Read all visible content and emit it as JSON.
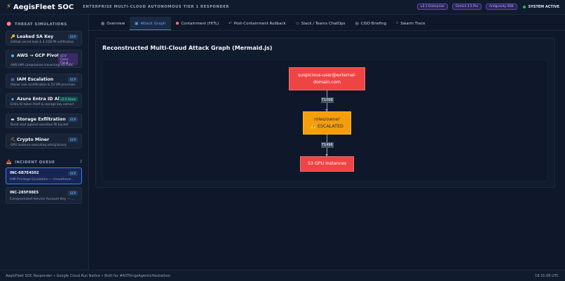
{
  "header": {
    "brand": "AegisFleet SOC",
    "tagline": "ENTERPRISE MULTI-CLOUD AUTONOMOUS TIER 1 RESPONDER",
    "badges": [
      "v2.1 Enterprise",
      "Gemini 3.5 Pro",
      "Antigravity SDK"
    ],
    "status": "SYSTEM ACTIVE"
  },
  "sidebar": {
    "threat_title": "THREAT SIMULATIONS",
    "simulations": [
      {
        "title": "Leaked SA Key",
        "desc": "GitHub secret leak & 4.2GB PII exfiltration",
        "tag": "GCP",
        "icon": "key-icon"
      },
      {
        "title": "AWS → GCP Pivot",
        "desc": "AWS IAM compromise traversing via OIDC",
        "tag": "v2.0 Cross-Cloud",
        "icon": "globe-icon"
      },
      {
        "title": "IAM Escalation",
        "desc": "Owner role modification & 53 VM provision",
        "tag": "GCP",
        "icon": "lock-icon"
      },
      {
        "title": "Azure Entra ID Abuse",
        "desc": "Entra ID token theft & storage key extract",
        "tag": "v2.0 Azure",
        "icon": "cloud-icon"
      },
      {
        "title": "Storage Exfiltration",
        "desc": "Burst read against sensitive PII bucket",
        "tag": "GCP",
        "icon": "storage-icon"
      },
      {
        "title": "Crypto Miner",
        "desc": "GPU instance executing xmrig binary",
        "tag": "GCP",
        "icon": "coin-icon"
      }
    ],
    "queue_title": "INCIDENT QUEUE",
    "queue_count": "2",
    "incidents": [
      {
        "id": "INC-6B7E4502",
        "desc": "IAM Privilege Escalation — Unauthoriz...",
        "tag": "GCP"
      },
      {
        "id": "INC-285F08E5",
        "desc": "Compromised Service Account Key — ...",
        "tag": "GCP"
      }
    ]
  },
  "tabs": [
    {
      "label": "Overview",
      "icon": "chart-icon"
    },
    {
      "label": "Attack Graph",
      "icon": "graph-icon"
    },
    {
      "label": "Containment (HITL)",
      "icon": "shield-icon"
    },
    {
      "label": "Post-Containment Rollback",
      "icon": "undo-icon"
    },
    {
      "label": "Slack / Teams ChatOps",
      "icon": "chat-icon"
    },
    {
      "label": "CISO Briefing",
      "icon": "document-icon"
    },
    {
      "label": "Swarm Trace",
      "icon": "search-icon"
    }
  ],
  "panel": {
    "title": "Reconstructed Multi-Cloud Attack Graph (Mermaid.js)",
    "nodes": {
      "n1_line1": "suspicious-user@external-",
      "n1_line2": "domain.com",
      "n2_line1": "roles/owner",
      "n2_line2": "⚠️ ESCALATED",
      "n3": "53 GPU Instances"
    },
    "edges": [
      "T1098",
      "T1496"
    ]
  },
  "footer": {
    "left": "AegisFleet SOC Responder • Google Cloud Run Native • Built for #AllThingsAgenticHackathon",
    "right": "18:31:08 UTC"
  },
  "colors": {
    "accent": "#3b82f6",
    "critical": "#ef4444",
    "warning": "#f59e0b",
    "bg": "#0f172a"
  }
}
